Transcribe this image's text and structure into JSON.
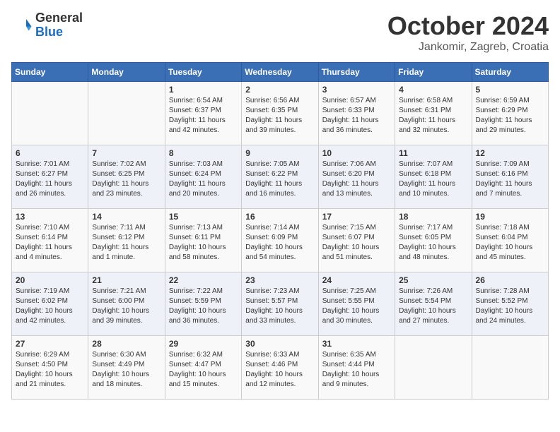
{
  "header": {
    "logo_general": "General",
    "logo_blue": "Blue",
    "title": "October 2024",
    "location": "Jankomir, Zagreb, Croatia"
  },
  "days_of_week": [
    "Sunday",
    "Monday",
    "Tuesday",
    "Wednesday",
    "Thursday",
    "Friday",
    "Saturday"
  ],
  "weeks": [
    [
      {
        "day": "",
        "info": ""
      },
      {
        "day": "",
        "info": ""
      },
      {
        "day": "1",
        "info": "Sunrise: 6:54 AM\nSunset: 6:37 PM\nDaylight: 11 hours and 42 minutes."
      },
      {
        "day": "2",
        "info": "Sunrise: 6:56 AM\nSunset: 6:35 PM\nDaylight: 11 hours and 39 minutes."
      },
      {
        "day": "3",
        "info": "Sunrise: 6:57 AM\nSunset: 6:33 PM\nDaylight: 11 hours and 36 minutes."
      },
      {
        "day": "4",
        "info": "Sunrise: 6:58 AM\nSunset: 6:31 PM\nDaylight: 11 hours and 32 minutes."
      },
      {
        "day": "5",
        "info": "Sunrise: 6:59 AM\nSunset: 6:29 PM\nDaylight: 11 hours and 29 minutes."
      }
    ],
    [
      {
        "day": "6",
        "info": "Sunrise: 7:01 AM\nSunset: 6:27 PM\nDaylight: 11 hours and 26 minutes."
      },
      {
        "day": "7",
        "info": "Sunrise: 7:02 AM\nSunset: 6:25 PM\nDaylight: 11 hours and 23 minutes."
      },
      {
        "day": "8",
        "info": "Sunrise: 7:03 AM\nSunset: 6:24 PM\nDaylight: 11 hours and 20 minutes."
      },
      {
        "day": "9",
        "info": "Sunrise: 7:05 AM\nSunset: 6:22 PM\nDaylight: 11 hours and 16 minutes."
      },
      {
        "day": "10",
        "info": "Sunrise: 7:06 AM\nSunset: 6:20 PM\nDaylight: 11 hours and 13 minutes."
      },
      {
        "day": "11",
        "info": "Sunrise: 7:07 AM\nSunset: 6:18 PM\nDaylight: 11 hours and 10 minutes."
      },
      {
        "day": "12",
        "info": "Sunrise: 7:09 AM\nSunset: 6:16 PM\nDaylight: 11 hours and 7 minutes."
      }
    ],
    [
      {
        "day": "13",
        "info": "Sunrise: 7:10 AM\nSunset: 6:14 PM\nDaylight: 11 hours and 4 minutes."
      },
      {
        "day": "14",
        "info": "Sunrise: 7:11 AM\nSunset: 6:12 PM\nDaylight: 11 hours and 1 minute."
      },
      {
        "day": "15",
        "info": "Sunrise: 7:13 AM\nSunset: 6:11 PM\nDaylight: 10 hours and 58 minutes."
      },
      {
        "day": "16",
        "info": "Sunrise: 7:14 AM\nSunset: 6:09 PM\nDaylight: 10 hours and 54 minutes."
      },
      {
        "day": "17",
        "info": "Sunrise: 7:15 AM\nSunset: 6:07 PM\nDaylight: 10 hours and 51 minutes."
      },
      {
        "day": "18",
        "info": "Sunrise: 7:17 AM\nSunset: 6:05 PM\nDaylight: 10 hours and 48 minutes."
      },
      {
        "day": "19",
        "info": "Sunrise: 7:18 AM\nSunset: 6:04 PM\nDaylight: 10 hours and 45 minutes."
      }
    ],
    [
      {
        "day": "20",
        "info": "Sunrise: 7:19 AM\nSunset: 6:02 PM\nDaylight: 10 hours and 42 minutes."
      },
      {
        "day": "21",
        "info": "Sunrise: 7:21 AM\nSunset: 6:00 PM\nDaylight: 10 hours and 39 minutes."
      },
      {
        "day": "22",
        "info": "Sunrise: 7:22 AM\nSunset: 5:59 PM\nDaylight: 10 hours and 36 minutes."
      },
      {
        "day": "23",
        "info": "Sunrise: 7:23 AM\nSunset: 5:57 PM\nDaylight: 10 hours and 33 minutes."
      },
      {
        "day": "24",
        "info": "Sunrise: 7:25 AM\nSunset: 5:55 PM\nDaylight: 10 hours and 30 minutes."
      },
      {
        "day": "25",
        "info": "Sunrise: 7:26 AM\nSunset: 5:54 PM\nDaylight: 10 hours and 27 minutes."
      },
      {
        "day": "26",
        "info": "Sunrise: 7:28 AM\nSunset: 5:52 PM\nDaylight: 10 hours and 24 minutes."
      }
    ],
    [
      {
        "day": "27",
        "info": "Sunrise: 6:29 AM\nSunset: 4:50 PM\nDaylight: 10 hours and 21 minutes."
      },
      {
        "day": "28",
        "info": "Sunrise: 6:30 AM\nSunset: 4:49 PM\nDaylight: 10 hours and 18 minutes."
      },
      {
        "day": "29",
        "info": "Sunrise: 6:32 AM\nSunset: 4:47 PM\nDaylight: 10 hours and 15 minutes."
      },
      {
        "day": "30",
        "info": "Sunrise: 6:33 AM\nSunset: 4:46 PM\nDaylight: 10 hours and 12 minutes."
      },
      {
        "day": "31",
        "info": "Sunrise: 6:35 AM\nSunset: 4:44 PM\nDaylight: 10 hours and 9 minutes."
      },
      {
        "day": "",
        "info": ""
      },
      {
        "day": "",
        "info": ""
      }
    ]
  ]
}
